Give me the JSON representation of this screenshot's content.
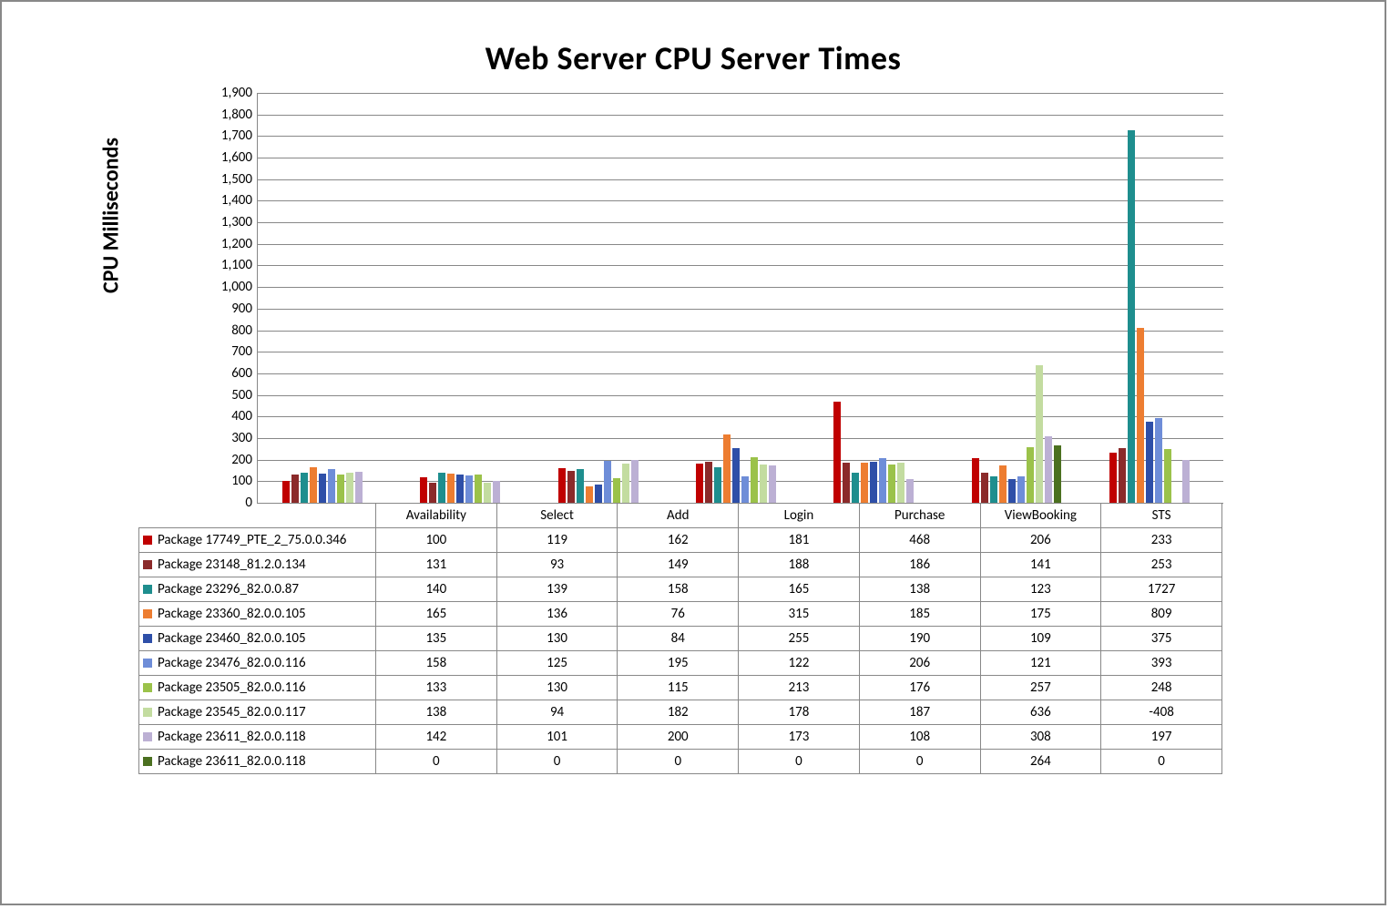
{
  "chart_data": {
    "type": "bar",
    "title": "Web  Server CPU Server Times",
    "xlabel": "",
    "ylabel": "CPU Milliseconds",
    "ylim": [
      0,
      1900
    ],
    "ystep": 100,
    "categories": [
      "Availability",
      "Select",
      "Add",
      "Login",
      "Purchase",
      "ViewBooking",
      "STS"
    ],
    "series": [
      {
        "name": "Package 17749_PTE_2_75.0.0.346",
        "color": "#c00000",
        "values": [
          100,
          119,
          162,
          181,
          468,
          206,
          233
        ]
      },
      {
        "name": "Package 23148_81.2.0.134",
        "color": "#8b2a2a",
        "values": [
          131,
          93,
          149,
          188,
          186,
          141,
          253
        ]
      },
      {
        "name": "Package 23296_82.0.0.87",
        "color": "#1e8e8e",
        "values": [
          140,
          139,
          158,
          165,
          138,
          123,
          1727
        ]
      },
      {
        "name": "Package 23360_82.0.0.105",
        "color": "#ed7d31",
        "values": [
          165,
          136,
          76,
          315,
          185,
          175,
          809
        ]
      },
      {
        "name": "Package 23460_82.0.0.105",
        "color": "#2e4fa8",
        "values": [
          135,
          130,
          84,
          255,
          190,
          109,
          375
        ]
      },
      {
        "name": "Package 23476_82.0.0.116",
        "color": "#6e8dd8",
        "values": [
          158,
          125,
          195,
          122,
          206,
          121,
          393
        ]
      },
      {
        "name": "Package 23505_82.0.0.116",
        "color": "#9bc24a",
        "values": [
          133,
          130,
          115,
          213,
          176,
          257,
          248
        ]
      },
      {
        "name": "Package 23545_82.0.0.117",
        "color": "#c3dca0",
        "values": [
          138,
          94,
          182,
          178,
          187,
          636,
          -408
        ]
      },
      {
        "name": "Package 23611_82.0.0.118",
        "color": "#bcb0d4",
        "values": [
          142,
          101,
          200,
          173,
          108,
          308,
          197
        ]
      },
      {
        "name": "Package 23611_82.0.0.118",
        "color": "#4b7020",
        "values": [
          0,
          0,
          0,
          0,
          0,
          264,
          0
        ]
      }
    ]
  }
}
